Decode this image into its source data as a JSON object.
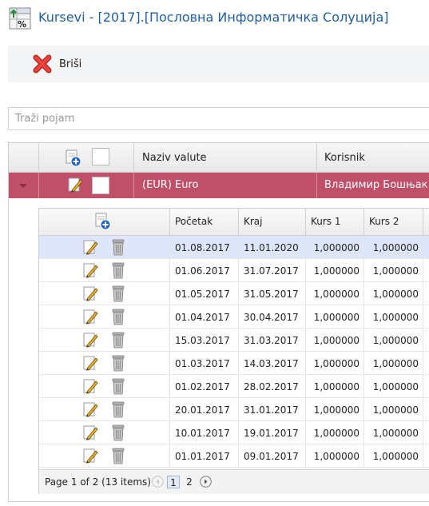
{
  "window": {
    "title": "Kursevi - [2017].[Пословна Информатичка Солуција]"
  },
  "toolbar": {
    "delete_label": "Briši"
  },
  "search": {
    "placeholder": "Traži pojam",
    "value": ""
  },
  "outer_grid": {
    "columns": [
      "Naziv valute",
      "Korisnik"
    ],
    "rows": [
      {
        "currency": "(EUR) Euro",
        "user": "Владимир Бошњак",
        "expanded": true,
        "selected": true
      }
    ]
  },
  "inner_grid": {
    "columns": [
      "Početak",
      "Kraj",
      "Kurs 1",
      "Kurs 2"
    ],
    "rows": [
      {
        "start": "01.08.2017",
        "end": "11.01.2020",
        "rate1": "1,000000",
        "rate2": "1,000000"
      },
      {
        "start": "01.06.2017",
        "end": "31.07.2017",
        "rate1": "1,000000",
        "rate2": "1,000000"
      },
      {
        "start": "01.05.2017",
        "end": "31.05.2017",
        "rate1": "1,000000",
        "rate2": "1,000000"
      },
      {
        "start": "01.04.2017",
        "end": "30.04.2017",
        "rate1": "1,000000",
        "rate2": "1,000000"
      },
      {
        "start": "15.03.2017",
        "end": "31.03.2017",
        "rate1": "1,000000",
        "rate2": "1,000000"
      },
      {
        "start": "01.03.2017",
        "end": "14.03.2017",
        "rate1": "1,000000",
        "rate2": "1,000000"
      },
      {
        "start": "01.02.2017",
        "end": "28.02.2017",
        "rate1": "1,000000",
        "rate2": "1,000000"
      },
      {
        "start": "20.01.2017",
        "end": "31.01.2017",
        "rate1": "1,000000",
        "rate2": "1,000000"
      },
      {
        "start": "10.01.2017",
        "end": "19.01.2017",
        "rate1": "1,000000",
        "rate2": "1,000000"
      },
      {
        "start": "01.01.2017",
        "end": "09.01.2017",
        "rate1": "1,000000",
        "rate2": "1,000000"
      }
    ],
    "selected_row": 0
  },
  "pager": {
    "info": "Page 1 of 2 (13 items)",
    "pages": [
      "1",
      "2"
    ],
    "current_page": "1"
  },
  "icons": {
    "app": "exchange-rate-icon",
    "delete": "red-x-icon",
    "add": "add-row-icon",
    "edit": "pencil-icon",
    "remove": "trash-icon",
    "prev": "chevron-left-icon",
    "next": "chevron-right-icon"
  },
  "colors": {
    "title": "#1f5fa6",
    "selected_outer_row": "#c0506a",
    "selected_inner_row": "#dde6fb",
    "delete_icon": "#d9302c"
  }
}
